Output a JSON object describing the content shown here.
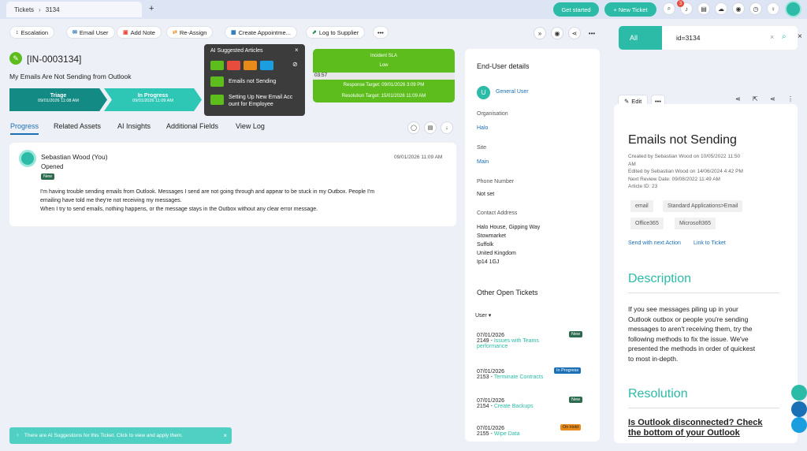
{
  "tab": {
    "root": "Tickets",
    "current": "3134",
    "plus": "+"
  },
  "topbar": {
    "get_started": "Get started",
    "new_ticket": "+ New Ticket",
    "notif_count": "3"
  },
  "actions": [
    "Escalation",
    "Email User",
    "Add Note",
    "Re-Assign",
    "Create Appointme...",
    "Log to Supplier",
    "•••"
  ],
  "ticket": {
    "id": "[IN-0003134]",
    "summary": "My Emails Are Not Sending from Outlook"
  },
  "stages": [
    {
      "name": "Triage",
      "date": "09/01/2026 11:08 AM"
    },
    {
      "name": "In Progress",
      "date": "09/01/2026 11:09 AM"
    }
  ],
  "tabs": [
    "Progress",
    "Related Assets",
    "AI Insights",
    "Additional Fields",
    "View Log"
  ],
  "ai_popup": {
    "title": "AI Suggested Articles",
    "items": [
      "Emails not Sending",
      "Setting Up New Email Acc ount for Employee"
    ]
  },
  "sla": {
    "title": "Incident SLA",
    "priority": "Low",
    "timer": "03:57",
    "response": "Response Target: 09/01/2026 3:09 PM",
    "resolution": "Resolution Target: 15/01/2026 11:09 AM"
  },
  "note": {
    "author": "Sebastian Wood (You)",
    "action": "Opened",
    "tag": "New",
    "date": "09/01/2026 11:09 AM",
    "lines": [
      "I'm having trouble sending emails from Outlook. Messages I send are not going through and appear to be stuck in my Outbox. People I'm",
      "emailing have told me they're not receiving my messages.",
      "When I try to send emails, nothing happens, or the message stays in the Outbox without any clear error message."
    ]
  },
  "enduser": {
    "heading": "End-User details",
    "user_initial": "U",
    "user": "General User",
    "org_label": "Organisation",
    "org": "Halo",
    "site_label": "Site",
    "site": "Main",
    "phone_label": "Phone Number",
    "phone": "Not set",
    "addr_label": "Contact Address",
    "address": [
      "Halo House, Gipping Way",
      "Stowmarket",
      "Suffolk",
      "United Kingdom",
      "Ip14 1GJ"
    ],
    "open_heading": "Other Open Tickets",
    "filter": "User"
  },
  "open_tickets": [
    {
      "date": "07/01/2026",
      "id": "2149",
      "title": "Issues with Teams",
      "title2": "performance",
      "status": "New",
      "color": "#2d6b4f"
    },
    {
      "date": "07/01/2026",
      "id": "2153",
      "title": "Terminate Contracts",
      "title2": "",
      "status": "In Progress",
      "color": "#1a6fb5"
    },
    {
      "date": "07/01/2026",
      "id": "2154",
      "title": "Create Backups",
      "title2": "",
      "status": "New",
      "color": "#2d6b4f"
    },
    {
      "date": "07/01/2026",
      "id": "2155",
      "title": "Wipe Data",
      "title2": "",
      "status": "On Hold",
      "color": "#e88a1a"
    }
  ],
  "search": {
    "all": "All",
    "query": "id=3134"
  },
  "kb": {
    "edit": "Edit",
    "title": "Emails not Sending",
    "meta": [
      "Created by Sebastian Wood on 10/05/2022 11:50",
      "AM",
      "Edited by Sebastian Wood on 14/06/2024 4:42 PM",
      "Next Review Date: 09/08/2022 11:49 AM",
      "Article ID: 23"
    ],
    "tags": [
      "email",
      "Standard Applications>Email",
      "Office365",
      "Microsoft365"
    ],
    "send_next": "Send with next Action",
    "link": "Link to Ticket",
    "desc_heading": "Description",
    "desc": [
      "If you see messages piling up in your",
      "Outlook outbox or people you're sending",
      "messages to aren't receiving them, try the",
      "following methods to fix the issue. We've",
      "presented the methods in order of quickest",
      "to most in-depth."
    ],
    "res_heading": "Resolution",
    "res_sub": [
      "Is Outlook disconnected? Check",
      "the bottom of your Outlook"
    ]
  },
  "toast": "There are AI Suggestions for this Ticket. Click to view and apply them."
}
